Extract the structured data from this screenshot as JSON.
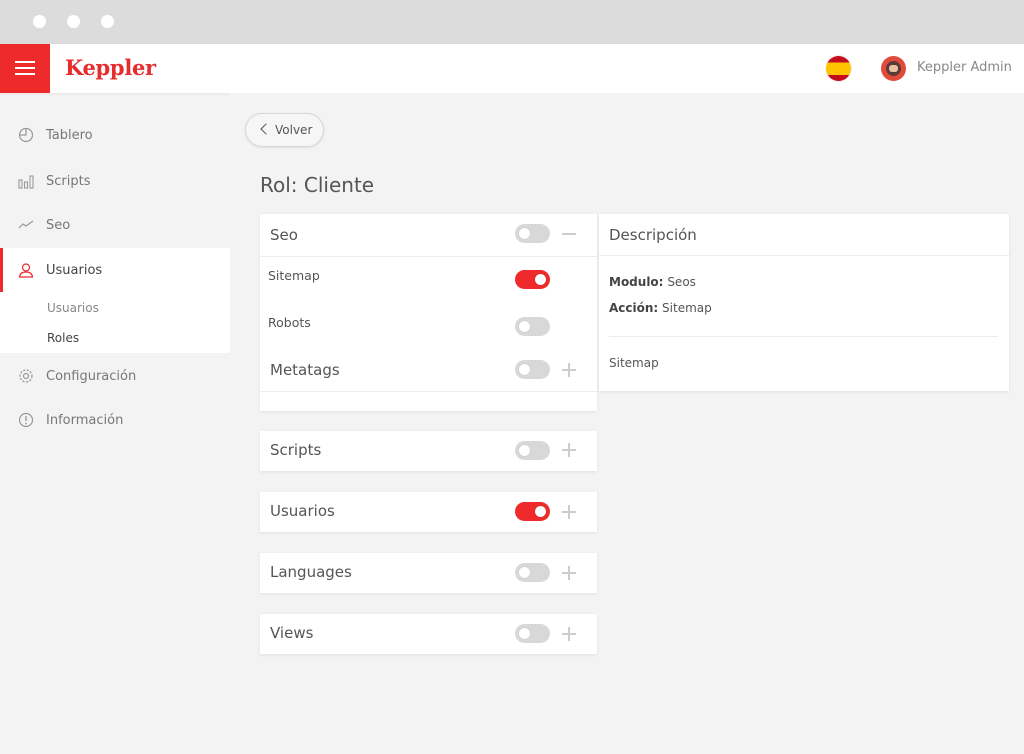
{
  "header": {
    "brand": "Keppler",
    "admin_name": "Keppler Admin",
    "flag_icon": "spain-flag-icon",
    "accent_color": "#ee2a2a"
  },
  "sidebar": {
    "items": [
      {
        "label": "Tablero",
        "icon": "dashboard-icon"
      },
      {
        "label": "Scripts",
        "icon": "bar-chart-icon"
      },
      {
        "label": "Seo",
        "icon": "trend-line-icon"
      },
      {
        "label": "Usuarios",
        "icon": "user-icon"
      },
      {
        "label": "Configuración",
        "icon": "gear-icon"
      },
      {
        "label": "Información",
        "icon": "info-icon"
      }
    ],
    "subitems": [
      {
        "label": "Usuarios"
      },
      {
        "label": "Roles"
      }
    ]
  },
  "main": {
    "back_label": "Volver",
    "page_title": "Rol: Cliente",
    "modules": [
      {
        "name": "Seo",
        "enabled": false,
        "expanded": true
      },
      {
        "name": "Scripts",
        "enabled": false,
        "expanded": false
      },
      {
        "name": "Usuarios",
        "enabled": true,
        "expanded": false
      },
      {
        "name": "Languages",
        "enabled": false,
        "expanded": false
      },
      {
        "name": "Views",
        "enabled": false,
        "expanded": false
      }
    ],
    "seo_children": [
      {
        "name": "Sitemap",
        "enabled": true
      },
      {
        "name": "Robots",
        "enabled": false
      },
      {
        "name": "Metatags",
        "enabled": false
      }
    ]
  },
  "description": {
    "title": "Descripción",
    "module_label": "Modulo:",
    "module_value": "Seos",
    "action_label": "Acción:",
    "action_value": "Sitemap",
    "body": "Sitemap"
  }
}
